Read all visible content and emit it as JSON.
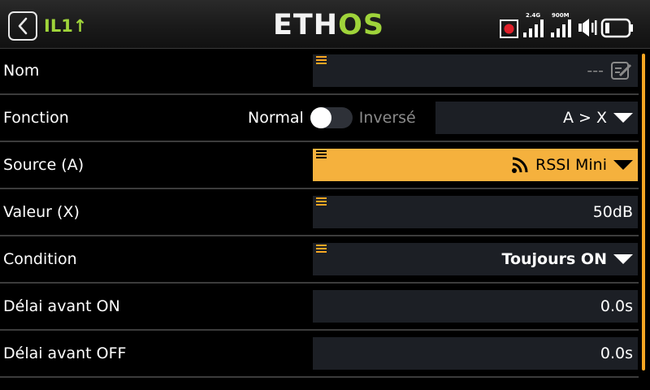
{
  "header": {
    "back_icon": "chevron-left-icon",
    "title": "IL1↑",
    "brand_part1": "ETH",
    "brand_part2": "OS",
    "status": {
      "rf_24_label": "2.4G",
      "rf_900_label": "900M",
      "rf_24_bars": 4,
      "rf_900_bars": 4,
      "icons": [
        "record-icon",
        "signal-2.4g-icon",
        "signal-900m-icon",
        "speaker-icon",
        "battery-icon"
      ]
    }
  },
  "rows": {
    "nom": {
      "label": "Nom",
      "value": "---",
      "icon": "edit-icon"
    },
    "fonction": {
      "label": "Fonction",
      "toggle_left": "Normal",
      "toggle_right": "Inversé",
      "toggle_on": false,
      "value": "A > X"
    },
    "source": {
      "label": "Source (A)",
      "value": "RSSI Mini",
      "icon": "rssi-icon"
    },
    "valeur": {
      "label": "Valeur (X)",
      "value": "50dB"
    },
    "condition": {
      "label": "Condition",
      "value": "Toujours ON"
    },
    "delai_on": {
      "label": "Délai avant ON",
      "value": "0.0s"
    },
    "delai_off": {
      "label": "Délai avant OFF",
      "value": "0.0s"
    }
  },
  "colors": {
    "accent_orange": "#f5b13d",
    "brand_green": "#9fd43a",
    "field_bg": "#1c1f25"
  }
}
